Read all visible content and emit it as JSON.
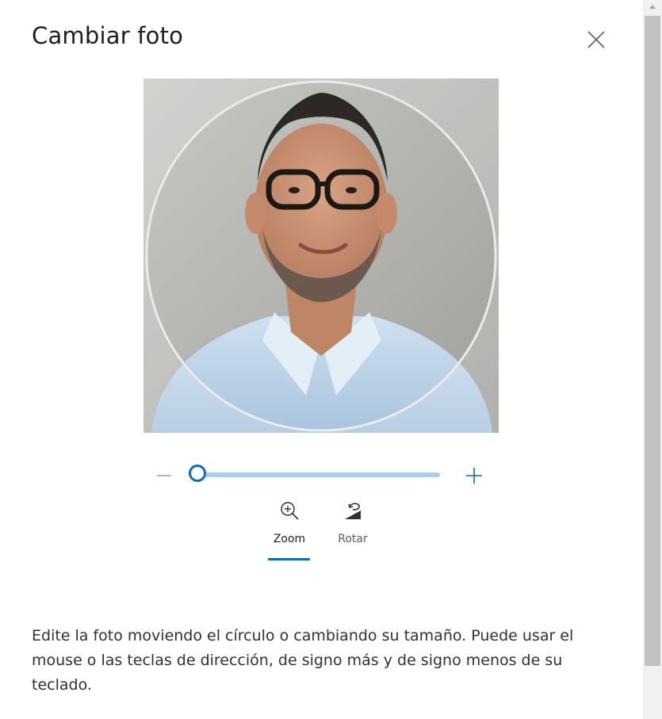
{
  "dialog": {
    "title": "Cambiar foto",
    "close_icon": "close-icon"
  },
  "photo": {
    "subject": "profile-photo",
    "crop_shape": "circle"
  },
  "zoom_slider": {
    "minus_icon": "minus-icon",
    "plus_icon": "plus-icon",
    "value_fraction": 0.0,
    "accent_color": "#0f6cbd",
    "track_color": "#a9cdea"
  },
  "tools": {
    "zoom": {
      "label": "Zoom",
      "icon": "zoom-in-icon",
      "selected": true
    },
    "rotate": {
      "label": "Rotar",
      "icon": "rotate-icon",
      "selected": false
    }
  },
  "description": "Edite la foto moviendo el círculo o cambiando su tamaño. Puede usar el mouse o las teclas de dirección, de signo más y de signo menos de su teclado.",
  "scrollbar": {
    "up_icon": "chevron-up-icon"
  }
}
